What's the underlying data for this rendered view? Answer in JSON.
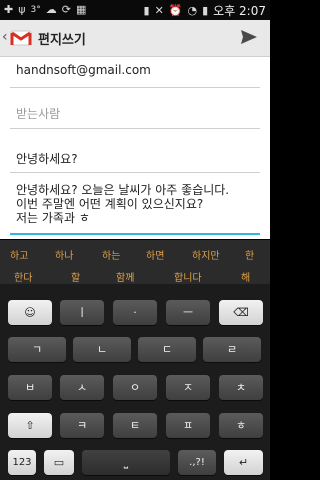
{
  "status_bar": {
    "left_icons": [
      "plus-icon",
      "usb-icon",
      "notification-count-icon",
      "weather-icon",
      "sync-icon",
      "storage-icon"
    ],
    "left_count": "3°",
    "signal_label": "100",
    "time": "오후 2:07"
  },
  "app_bar": {
    "title": "편지쓰기",
    "send_icon": "send-icon"
  },
  "compose": {
    "from": "handnsoft@gmail.com",
    "to_placeholder": "받는사람",
    "subject": "안녕하세요?",
    "body": [
      "안녕하세요? 오늘은 날씨가 아주 좋습니다.",
      "이번 주말엔 어떤 계획이 있으신지요?",
      "저는 가족과 ㅎ"
    ]
  },
  "keyboard": {
    "suggestions_row1": [
      "하고",
      "하나",
      "하는",
      "하면",
      "하지만",
      "한"
    ],
    "suggestions_row2": [
      "한다",
      "할",
      "함께",
      "합니다",
      "해"
    ],
    "row0": [
      "☺",
      "ㅣ",
      "·",
      "ㅡ",
      "⌫"
    ],
    "row1": [
      "ㄱ",
      "ㄴ",
      "ㄷ",
      "ㄹ"
    ],
    "row2": [
      "ㅂ",
      "ㅅ",
      "ㅇ",
      "ㅈ",
      "ㅊ"
    ],
    "row3": [
      "⇧",
      "ㅋ",
      "ㅌ",
      "ㅍ",
      "ㅎ"
    ],
    "row4": {
      "num": "123",
      "dot_keys": ".,?!",
      "enter": "↵"
    },
    "colors": {
      "suggestion": "#e0a14a",
      "key_dark": "#3f3f3f",
      "key_light": "#e6e6e6"
    }
  }
}
